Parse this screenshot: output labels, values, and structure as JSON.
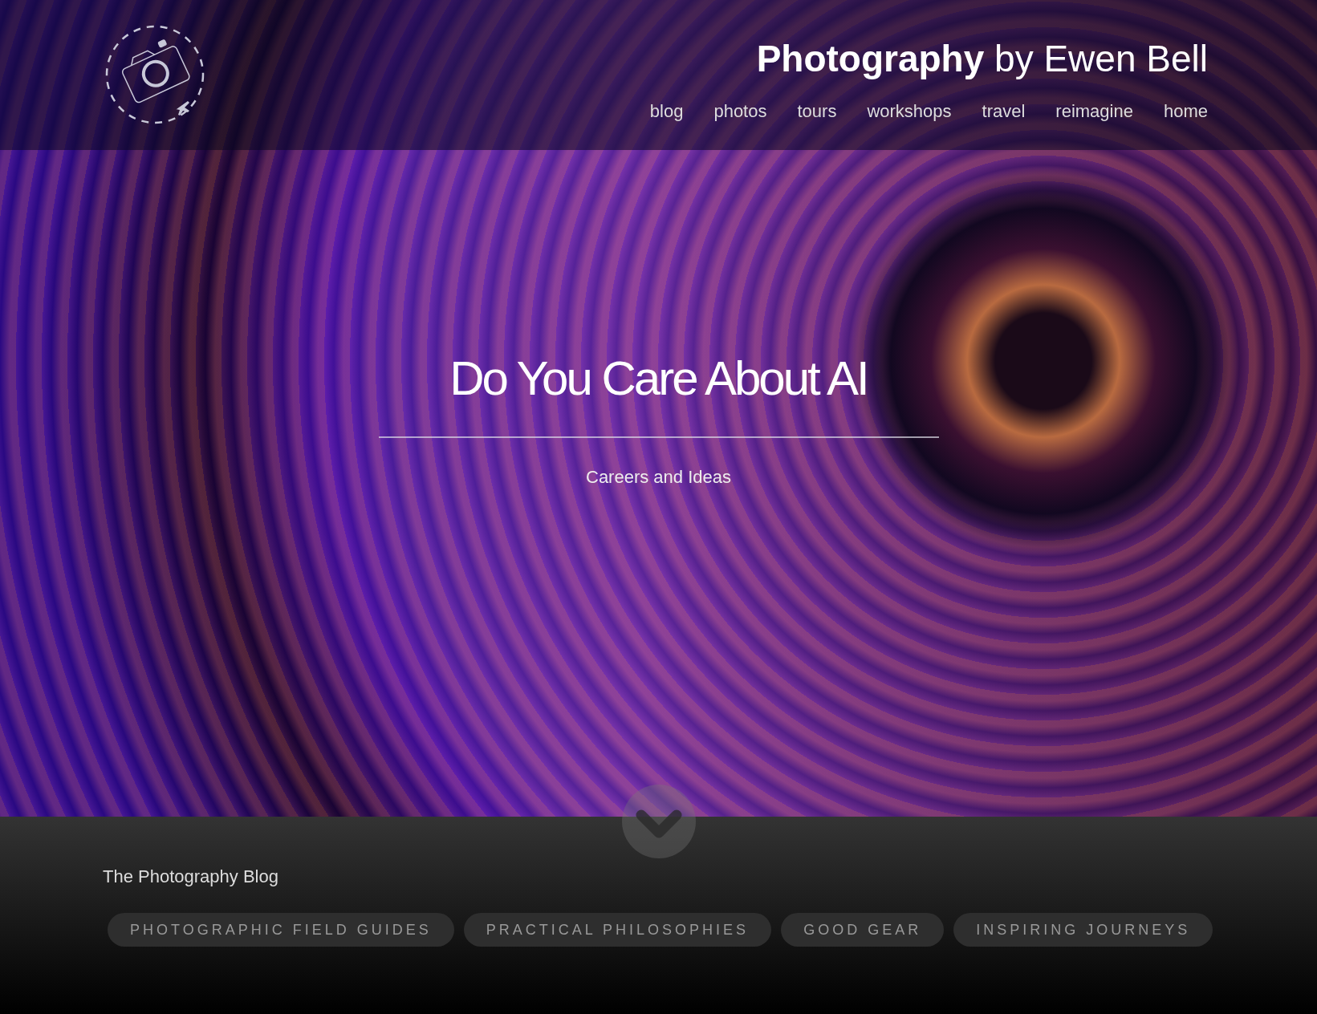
{
  "header": {
    "title": "**Photography** by Ewen Bell",
    "nav": [
      {
        "label": "blog"
      },
      {
        "label": "photos"
      },
      {
        "label": "tours"
      },
      {
        "label": "workshops"
      },
      {
        "label": "travel"
      },
      {
        "label": "reimagine"
      },
      {
        "label": "home"
      }
    ]
  },
  "hero": {
    "title": "Do You Care About AI",
    "subtitle": "Careers and Ideas"
  },
  "blog": {
    "heading": "The Photography Blog",
    "categories": [
      {
        "label": "PHOTOGRAPHIC FIELD GUIDES"
      },
      {
        "label": "PRACTICAL PHILOSOPHIES"
      },
      {
        "label": "GOOD GEAR"
      },
      {
        "label": "INSPIRING JOURNEYS"
      }
    ]
  }
}
